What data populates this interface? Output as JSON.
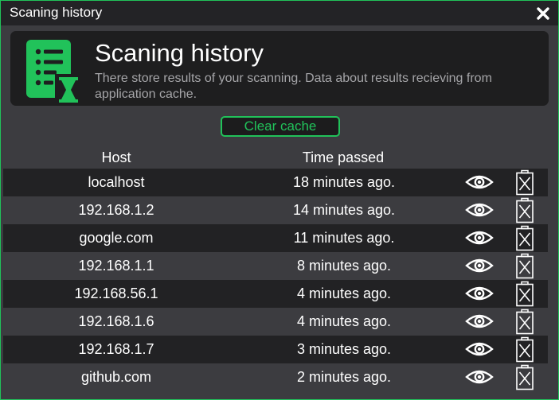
{
  "window": {
    "title": "Scaning history"
  },
  "header": {
    "title": "Scaning history",
    "description": "There store results of your scanning. Data about results recieving from application cache."
  },
  "actions": {
    "clear_label": "Clear cache"
  },
  "table": {
    "columns": [
      "Host",
      "Time passed"
    ],
    "rows": [
      {
        "host": "localhost",
        "time": "18 minutes ago."
      },
      {
        "host": "192.168.1.2",
        "time": "14 minutes ago."
      },
      {
        "host": "google.com",
        "time": "11 minutes ago."
      },
      {
        "host": "192.168.1.1",
        "time": "8 minutes ago."
      },
      {
        "host": "192.168.56.1",
        "time": "4 minutes ago."
      },
      {
        "host": "192.168.1.6",
        "time": "4 minutes ago."
      },
      {
        "host": "192.168.1.7",
        "time": "3 minutes ago."
      },
      {
        "host": "github.com",
        "time": "2 minutes ago."
      }
    ]
  },
  "icons": {
    "close": "close-icon",
    "header": "history-list-hourglass-icon",
    "view": "eye-icon",
    "delete": "trash-icon"
  },
  "colors": {
    "accent": "#21c25a",
    "titlebar": "#232326",
    "background": "#3c3c40",
    "row_dark": "#222224"
  }
}
